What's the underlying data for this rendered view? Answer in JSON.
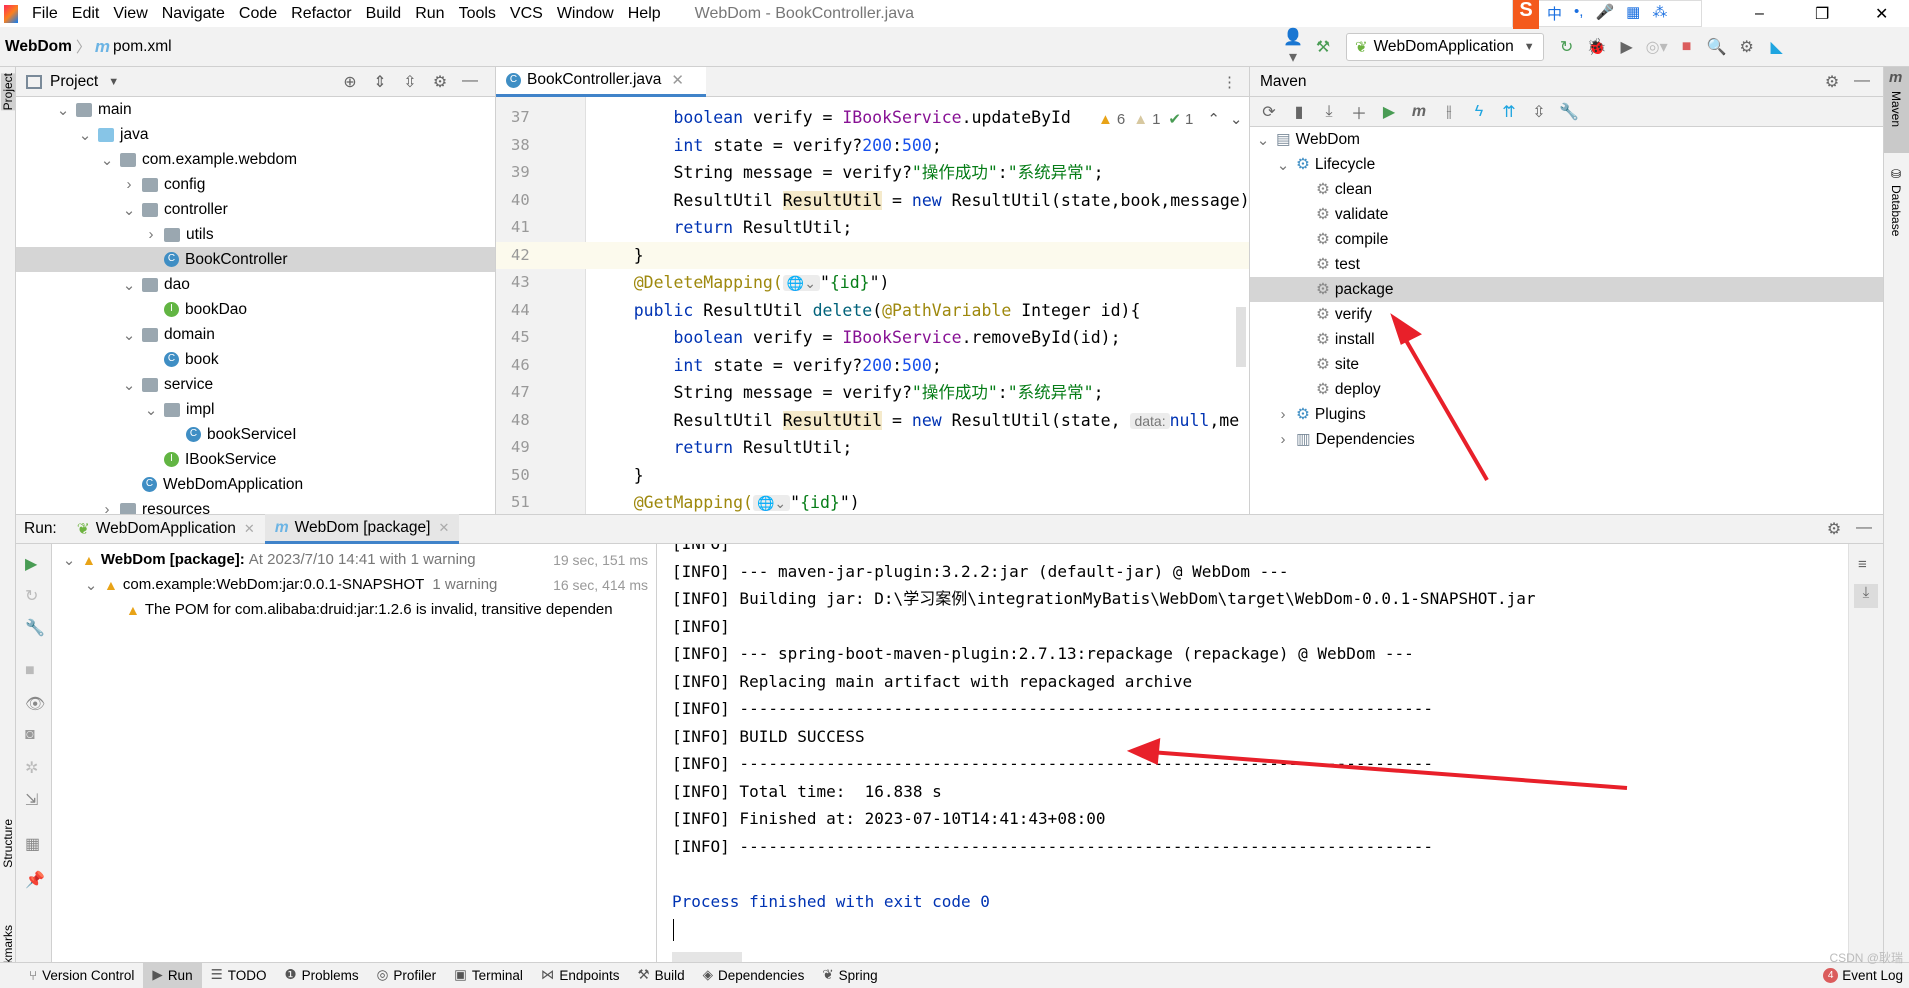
{
  "menu": {
    "items": [
      "File",
      "Edit",
      "View",
      "Navigate",
      "Code",
      "Refactor",
      "Build",
      "Run",
      "Tools",
      "VCS",
      "Window",
      "Help"
    ],
    "title": "WebDom - BookController.java"
  },
  "ime": {
    "items": [
      "中",
      "•,",
      "🎤",
      "▦",
      "⁂"
    ]
  },
  "nav": {
    "project": "WebDom",
    "file": "pom.xml",
    "run_config": "WebDomApplication"
  },
  "project": {
    "header": "Project",
    "rows": [
      {
        "label": "main",
        "level": 0,
        "type": "folder",
        "open": true
      },
      {
        "label": "java",
        "level": 1,
        "type": "folder-blue",
        "open": true
      },
      {
        "label": "com.example.webdom",
        "level": 2,
        "type": "folder",
        "open": true
      },
      {
        "label": "config",
        "level": 3,
        "type": "folder",
        "open": false
      },
      {
        "label": "controller",
        "level": 3,
        "type": "folder",
        "open": true
      },
      {
        "label": "utils",
        "level": 4,
        "type": "folder",
        "open": false
      },
      {
        "label": "BookController",
        "level": 4,
        "type": "class",
        "selected": true
      },
      {
        "label": "dao",
        "level": 3,
        "type": "folder",
        "open": true
      },
      {
        "label": "bookDao",
        "level": 4,
        "type": "interface"
      },
      {
        "label": "domain",
        "level": 3,
        "type": "folder",
        "open": true
      },
      {
        "label": "book",
        "level": 4,
        "type": "class"
      },
      {
        "label": "service",
        "level": 3,
        "type": "folder",
        "open": true
      },
      {
        "label": "impl",
        "level": 4,
        "type": "folder",
        "open": true
      },
      {
        "label": "bookServiceI",
        "level": 5,
        "type": "class"
      },
      {
        "label": "IBookService",
        "level": 4,
        "type": "interface"
      },
      {
        "label": "WebDomApplication",
        "level": 3,
        "type": "class"
      },
      {
        "label": "resources",
        "level": 2,
        "type": "folder",
        "open": false
      }
    ]
  },
  "editor": {
    "tab": "BookController.java",
    "inspections": {
      "warnings": "6",
      "weak_warnings": "1",
      "typos": "1"
    },
    "lines": [
      {
        "n": "37",
        "t": [
          [
            "        "
          ],
          [
            "boolean",
            "kw"
          ],
          [
            " verify = "
          ],
          [
            "IBookService",
            "pu"
          ],
          [
            ".updateById"
          ]
        ]
      },
      {
        "n": "38",
        "t": [
          [
            "        "
          ],
          [
            "int",
            "kw"
          ],
          [
            " state = verify?"
          ],
          [
            "200",
            "nm"
          ],
          [
            ":"
          ],
          [
            "500",
            "nm"
          ],
          [
            ";"
          ]
        ]
      },
      {
        "n": "39",
        "t": [
          [
            "        String message = verify?"
          ],
          [
            "\"操作成功\"",
            "st"
          ],
          [
            ":"
          ],
          [
            "\"系统异常\"",
            "st"
          ],
          [
            ";"
          ]
        ]
      },
      {
        "n": "40",
        "t": [
          [
            "        ResultUtil "
          ],
          [
            "ResultUtil",
            "hl"
          ],
          [
            " = "
          ],
          [
            "new",
            "kw"
          ],
          [
            " ResultUtil(state,book,message)"
          ]
        ]
      },
      {
        "n": "41",
        "t": [
          [
            "        "
          ],
          [
            "return",
            "kw"
          ],
          [
            " ResultUtil;"
          ]
        ]
      },
      {
        "n": "42",
        "t": [
          [
            "    }"
          ]
        ],
        "current": true
      },
      {
        "n": "43",
        "t": [
          [
            "    "
          ],
          [
            "@DeleteMapping(",
            "an"
          ],
          [
            "🌐⌄",
            "hint"
          ],
          [
            "\""
          ],
          [
            "{id}",
            "st"
          ],
          [
            "\")"
          ]
        ]
      },
      {
        "n": "44",
        "t": [
          [
            "    "
          ],
          [
            "public",
            "kw"
          ],
          [
            " ResultUtil "
          ],
          [
            "delete",
            "fn"
          ],
          [
            "("
          ],
          [
            "@PathVariable",
            "an"
          ],
          [
            " Integer id){"
          ]
        ]
      },
      {
        "n": "45",
        "t": [
          [
            "        "
          ],
          [
            "boolean",
            "kw"
          ],
          [
            " verify = "
          ],
          [
            "IBookService",
            "pu"
          ],
          [
            ".removeById(id);"
          ]
        ]
      },
      {
        "n": "46",
        "t": [
          [
            "        "
          ],
          [
            "int",
            "kw"
          ],
          [
            " state = verify?"
          ],
          [
            "200",
            "nm"
          ],
          [
            ":"
          ],
          [
            "500",
            "nm"
          ],
          [
            ";"
          ]
        ]
      },
      {
        "n": "47",
        "t": [
          [
            "        String message = verify?"
          ],
          [
            "\"操作成功\"",
            "st"
          ],
          [
            ":"
          ],
          [
            "\"系统异常\"",
            "st"
          ],
          [
            ";"
          ]
        ]
      },
      {
        "n": "48",
        "t": [
          [
            "        ResultUtil "
          ],
          [
            "ResultUtil",
            "hl"
          ],
          [
            " = "
          ],
          [
            "new",
            "kw"
          ],
          [
            " ResultUtil(state, "
          ],
          [
            "data:",
            "hint"
          ],
          [
            "null",
            "kw"
          ],
          [
            ",me"
          ]
        ]
      },
      {
        "n": "49",
        "t": [
          [
            "        "
          ],
          [
            "return",
            "kw"
          ],
          [
            " ResultUtil;"
          ]
        ]
      },
      {
        "n": "50",
        "t": [
          [
            "    }"
          ]
        ]
      },
      {
        "n": "51",
        "t": [
          [
            "    "
          ],
          [
            "@GetMapping(",
            "an"
          ],
          [
            "🌐⌄",
            "hint"
          ],
          [
            "\""
          ],
          [
            "{id}",
            "st"
          ],
          [
            "\")"
          ]
        ]
      }
    ]
  },
  "maven": {
    "header": "Maven",
    "rows": [
      {
        "label": "WebDom",
        "level": 0,
        "type": "project",
        "open": true
      },
      {
        "label": "Lifecycle",
        "level": 1,
        "type": "lifecycle",
        "open": true
      },
      {
        "label": "clean",
        "level": 2,
        "type": "goal"
      },
      {
        "label": "validate",
        "level": 2,
        "type": "goal"
      },
      {
        "label": "compile",
        "level": 2,
        "type": "goal"
      },
      {
        "label": "test",
        "level": 2,
        "type": "goal"
      },
      {
        "label": "package",
        "level": 2,
        "type": "goal",
        "selected": true
      },
      {
        "label": "verify",
        "level": 2,
        "type": "goal"
      },
      {
        "label": "install",
        "level": 2,
        "type": "goal"
      },
      {
        "label": "site",
        "level": 2,
        "type": "goal"
      },
      {
        "label": "deploy",
        "level": 2,
        "type": "goal"
      },
      {
        "label": "Plugins",
        "level": 1,
        "type": "plugins",
        "open": false
      },
      {
        "label": "Dependencies",
        "level": 1,
        "type": "deps",
        "open": false
      }
    ]
  },
  "stripes": {
    "left": [
      "Project",
      "Structure",
      "Bookmarks"
    ],
    "right": [
      "Maven",
      "Database"
    ]
  },
  "run": {
    "label": "Run:",
    "tabs": [
      {
        "label": "WebDomApplication",
        "active": false
      },
      {
        "label": "WebDom [package]",
        "active": true
      }
    ],
    "tree": [
      {
        "bold": "WebDom [package]:",
        "text": "At 2023/7/10 14:41 with 1 warning",
        "time": "19 sec, 151 ms",
        "level": 0
      },
      {
        "bold": "",
        "text": "com.example:WebDom:jar:0.0.1-SNAPSHOT",
        "grey": "1 warning",
        "time": "16 sec, 414 ms",
        "level": 1
      },
      {
        "bold": "",
        "text": "The POM for com.alibaba:druid:jar:1.2.6 is invalid, transitive dependen",
        "time": "",
        "level": 2
      }
    ],
    "console": [
      "[INFO]",
      "[INFO] --- maven-jar-plugin:3.2.2:jar (default-jar) @ WebDom ---",
      "[INFO] Building jar: D:\\学习案例\\integrationMyBatis\\WebDom\\target\\WebDom-0.0.1-SNAPSHOT.jar",
      "[INFO]",
      "[INFO] --- spring-boot-maven-plugin:2.7.13:repackage (repackage) @ WebDom ---",
      "[INFO] Replacing main artifact with repackaged archive",
      "[INFO] ------------------------------------------------------------------------",
      "[INFO] BUILD SUCCESS",
      "[INFO] ------------------------------------------------------------------------",
      "[INFO] Total time:  16.838 s",
      "[INFO] Finished at: 2023-07-10T14:41:43+08:00",
      "[INFO] ------------------------------------------------------------------------",
      "",
      "Process finished with exit code 0"
    ]
  },
  "statusbar": {
    "items": [
      [
        "⑂",
        "Version Control"
      ],
      [
        "▶",
        "Run"
      ],
      [
        "☰",
        "TODO"
      ],
      [
        "❶",
        "Problems"
      ],
      [
        "◎",
        "Profiler"
      ],
      [
        "▣",
        "Terminal"
      ],
      [
        "⋈",
        "Endpoints"
      ],
      [
        "⚒",
        "Build"
      ],
      [
        "◈",
        "Dependencies"
      ],
      [
        "❦",
        "Spring"
      ]
    ],
    "event_badge": "4",
    "event_log": "Event Log",
    "watermark": "CSDN @耿瑞"
  },
  "colors": {
    "accent": "#4083c9",
    "annotation_arrow": "#e8202a",
    "success_green": "#499c54"
  }
}
